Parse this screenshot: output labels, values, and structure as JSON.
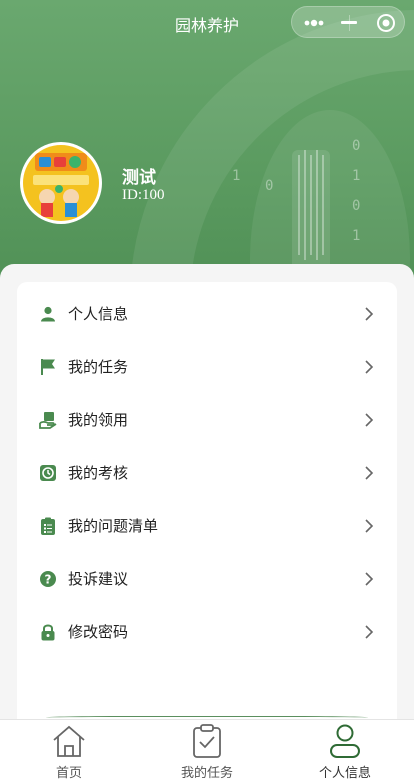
{
  "app": {
    "title": "园林养护"
  },
  "colors": {
    "brand": "#5a9a5f",
    "icon_green": "#4a8a4f",
    "text": "#222222"
  },
  "user": {
    "name": "测试",
    "id_text": "ID:100",
    "avatar": "children-book-cover-image"
  },
  "menu": [
    {
      "label": "个人信息",
      "icon": "person-icon"
    },
    {
      "label": "我的任务",
      "icon": "flag-icon"
    },
    {
      "label": "我的领用",
      "icon": "hand-box-icon"
    },
    {
      "label": "我的考核",
      "icon": "clock-icon"
    },
    {
      "label": "我的问题清单",
      "icon": "clipboard-list-icon"
    },
    {
      "label": "投诉建议",
      "icon": "question-circle-icon"
    },
    {
      "label": "修改密码",
      "icon": "lock-icon"
    }
  ],
  "tabbar": [
    {
      "label": "首页",
      "icon": "home-icon"
    },
    {
      "label": "我的任务",
      "icon": "clipboard-check-icon"
    },
    {
      "label": "个人信息",
      "icon": "person-outline-icon",
      "active": true
    }
  ]
}
